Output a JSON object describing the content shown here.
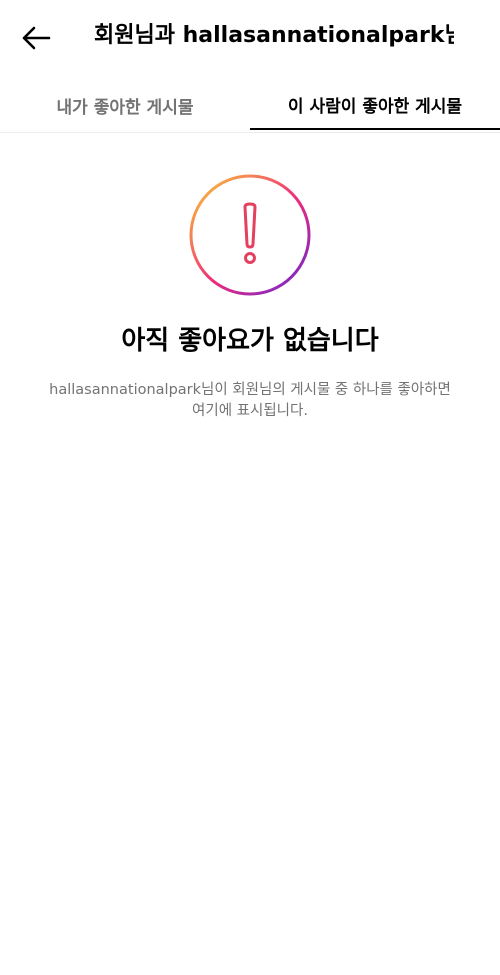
{
  "header": {
    "title": "회원님과 hallasannationalpark님",
    "back_icon": "arrow-left-icon"
  },
  "tabs": [
    {
      "label": "내가 좋아한 게시물",
      "active": false
    },
    {
      "label": "이 사람이 좋아한 게시물",
      "active": true
    }
  ],
  "empty_state": {
    "icon": "alert-circle-icon",
    "title": "아직 좋아요가 없습니다",
    "description_line1": "hallasannationalpark님이 회원님의 게시물 중 하나를 좋아하면",
    "description_line2": "여기에 표시됩니다.",
    "gradient_colors": [
      "#f9ce34",
      "#ee2a7b",
      "#6228d7"
    ]
  }
}
